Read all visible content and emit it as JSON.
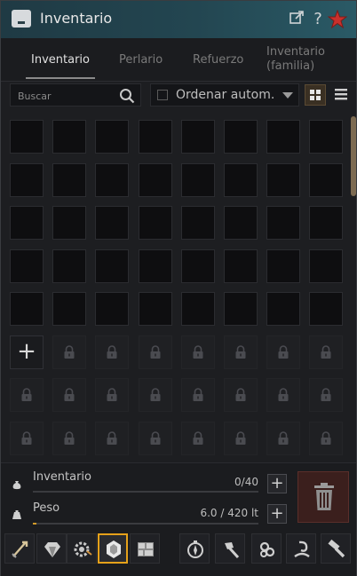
{
  "window": {
    "title": "Inventario"
  },
  "tabs": [
    {
      "label": "Inventario",
      "active": true
    },
    {
      "label": "Perlario",
      "active": false
    },
    {
      "label": "Refuerzo",
      "active": false
    },
    {
      "label": "Inventario (familia)",
      "active": false
    }
  ],
  "toolbar": {
    "search_placeholder": "Buscar",
    "sort_label": "Ordenar autom.",
    "sort_checked": false
  },
  "grid": {
    "columns": 8,
    "open_slots": 40,
    "add_slot_symbol": "+"
  },
  "footer": {
    "inventory_label": "Inventario",
    "inventory_value": "0/40",
    "weight_label": "Peso",
    "weight_value": "6.0 / 420 lt"
  },
  "categories": [
    {
      "icon": "sword-icon"
    },
    {
      "icon": "gem-icon"
    },
    {
      "icon": "gear-pet-icon"
    },
    {
      "icon": "crystal-icon",
      "selected": true
    },
    {
      "icon": "block-icon"
    },
    {
      "icon": "compass-icon"
    },
    {
      "icon": "axe-icon"
    },
    {
      "icon": "rune-icon"
    },
    {
      "icon": "fishing-icon"
    },
    {
      "icon": "hammer-icon"
    }
  ],
  "colors": {
    "accent": "#e5a11a",
    "title_bar": "#234651",
    "trash_bg": "#3b1f1d"
  }
}
